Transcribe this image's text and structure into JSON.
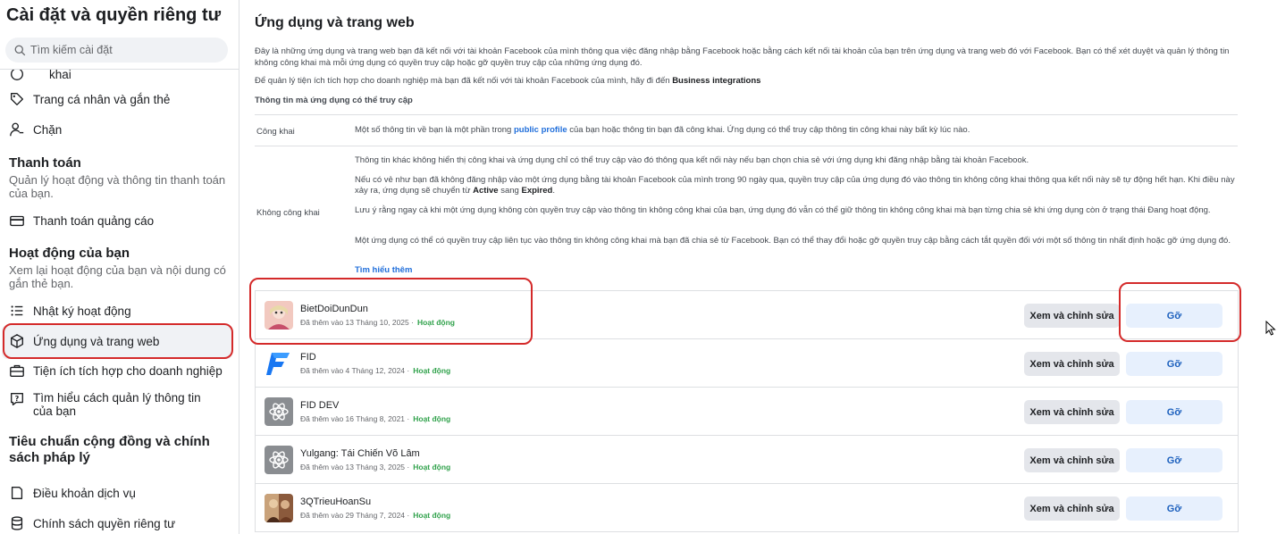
{
  "sidebar": {
    "title": "Cài đặt và quyền riêng tư",
    "search_placeholder": "Tìm kiếm cài đặt",
    "partial_item": "khai",
    "items_top": [
      {
        "label": "Trang cá nhân và gắn thẻ",
        "icon": "tag-icon"
      },
      {
        "label": "Chặn",
        "icon": "block-user-icon"
      }
    ],
    "payment": {
      "heading": "Thanh toán",
      "desc": "Quản lý hoạt động và thông tin thanh toán của bạn.",
      "item": "Thanh toán quảng cáo"
    },
    "activity": {
      "heading": "Hoạt động của bạn",
      "desc": "Xem lại hoạt động của bạn và nội dung có gắn thẻ bạn.",
      "items": [
        {
          "label": "Nhật ký hoạt động",
          "icon": "list-icon"
        },
        {
          "label": "Ứng dụng và trang web",
          "icon": "cube-icon"
        },
        {
          "label": "Tiện ích tích hợp cho doanh nghiệp",
          "icon": "briefcase-icon"
        },
        {
          "label": "Tìm hiểu cách quản lý thông tin của bạn",
          "icon": "help-icon"
        }
      ]
    },
    "community": {
      "heading": "Tiêu chuẩn cộng đồng và chính sách pháp lý",
      "items": [
        {
          "label": "Điều khoản dịch vụ",
          "icon": "book-icon"
        },
        {
          "label": "Chính sách quyền riêng tư",
          "icon": "database-icon"
        }
      ]
    }
  },
  "main": {
    "title": "Ứng dụng và trang web",
    "intro": "Đây là những ứng dụng và trang web bạn đã kết nối với tài khoản Facebook của mình thông qua việc đăng nhập bằng Facebook hoặc bằng cách kết nối tài khoản của bạn trên ứng dụng và trang web đó với Facebook. Bạn có thể xét duyệt và quản lý thông tin không công khai mà mỗi ứng dụng có quyền truy cập hoặc gỡ quyền truy cập của những ứng dụng đó.",
    "intro2_prefix": "Để quản lý tiện ích tích hợp cho doanh nghiệp mà bạn đã kết nối với tài khoản Facebook của mình, hãy đi đến ",
    "intro2_link": "Business integrations",
    "subheading": "Thông tin mà ứng dụng có thể truy cập",
    "public": {
      "label": "Công khai",
      "text_prefix": "Một số thông tin về bạn là một phần trong ",
      "text_link": "public profile",
      "text_suffix": " của bạn hoặc thông tin bạn đã công khai. Ứng dụng có thể truy cập thông tin công khai này bất kỳ lúc nào."
    },
    "nonpublic": {
      "label": "Không công khai",
      "p1": "Thông tin khác không hiển thị công khai và ứng dụng chỉ có thể truy cập vào đó thông qua kết nối này nếu bạn chọn chia sẻ với ứng dụng khi đăng nhập bằng tài khoản Facebook.",
      "p2_prefix": "Nếu có vẻ như bạn đã không đăng nhập vào một ứng dụng bằng tài khoản Facebook của mình trong 90 ngày qua, quyền truy cập của ứng dụng đó vào thông tin không công khai thông qua kết nối này sẽ tự động hết hạn. Khi điều này xảy ra, ứng dụng sẽ chuyển từ ",
      "p2_active": "Active",
      "p2_mid": " sang ",
      "p2_expired": "Expired",
      "p2_suffix": ".",
      "p3": "Lưu ý rằng ngay cả khi một ứng dụng không còn quyền truy cập vào thông tin không công khai của bạn, ứng dụng đó vẫn có thể giữ thông tin không công khai mà bạn từng chia sẻ khi ứng dụng còn ở trạng thái Đang hoạt động.",
      "p4": "Một ứng dụng có thể có quyền truy cập liên tục vào thông tin không công khai mà bạn đã chia sẻ từ Facebook. Bạn có thể thay đổi hoặc gỡ quyền truy cập bằng cách tắt quyền đối với một số thông tin nhất định hoặc gỡ ứng dụng đó."
    },
    "learn_more": "Tìm hiểu thêm",
    "edit_label": "Xem và chỉnh sửa",
    "remove_label": "Gỡ",
    "apps": [
      {
        "name": "BietDoiDunDun",
        "added": "Đã thêm vào 13 Tháng 10, 2025 ·",
        "status": "Hoạt động",
        "icon": "photo-avatar-icon"
      },
      {
        "name": "FID",
        "added": "Đã thêm vào 4 Tháng 12, 2024 ·",
        "status": "Hoạt động",
        "icon": "f-logo-icon"
      },
      {
        "name": "FID DEV",
        "added": "Đã thêm vào 16 Tháng 8, 2021 ·",
        "status": "Hoạt động",
        "icon": "atom-icon"
      },
      {
        "name": "Yulgang: Tái Chiến Võ Lâm",
        "added": "Đã thêm vào 13 Tháng 3, 2025 ·",
        "status": "Hoạt động",
        "icon": "atom-icon"
      },
      {
        "name": "3QTrieuHoanSu",
        "added": "Đã thêm vào 29 Tháng 7, 2024 ·",
        "status": "Hoạt động",
        "icon": "photo-avatar-icon"
      }
    ]
  },
  "colors": {
    "accent": "#216fdb",
    "status_active": "#31a24c",
    "highlight": "#d42a2a"
  }
}
